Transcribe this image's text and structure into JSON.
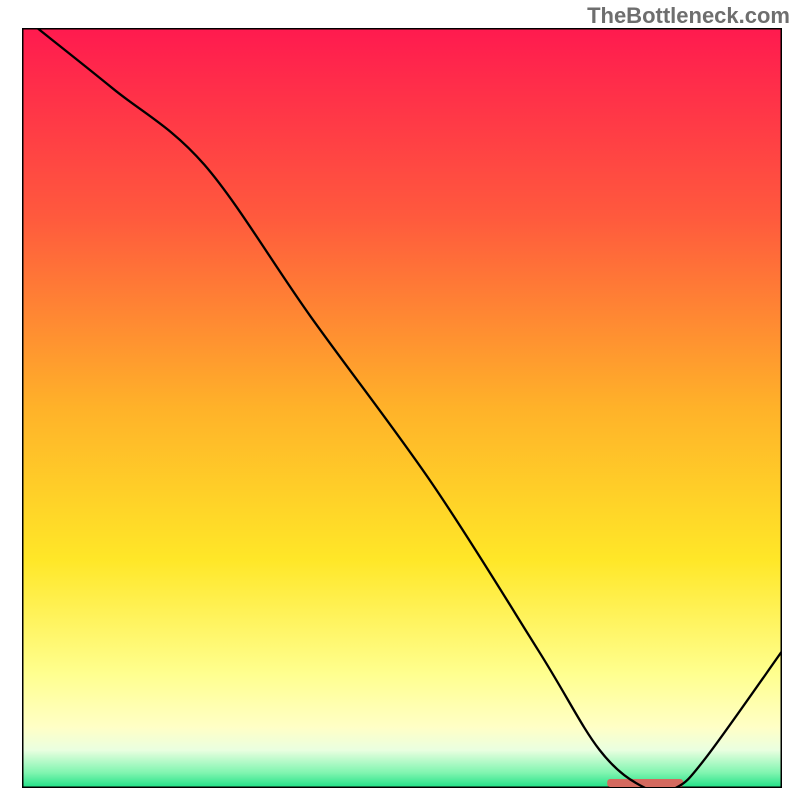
{
  "watermark": "TheBottleneck.com",
  "chart_data": {
    "type": "line",
    "title": "",
    "xlabel": "",
    "ylabel": "",
    "xlim": [
      0,
      100
    ],
    "ylim": [
      0,
      100
    ],
    "series": [
      {
        "name": "curve",
        "x": [
          2,
          12,
          24,
          38,
          54,
          68,
          76,
          82,
          86,
          90,
          100
        ],
        "y": [
          100,
          92,
          82,
          62,
          40,
          18,
          5,
          0,
          0,
          4,
          18
        ]
      }
    ],
    "markers": [
      {
        "name": "red-band",
        "x_start": 77,
        "x_end": 87,
        "y": 0,
        "color": "#d46a5f"
      }
    ],
    "background": {
      "gradient_stops": [
        {
          "offset": 0.0,
          "color": "#ff1a4f"
        },
        {
          "offset": 0.25,
          "color": "#ff5a3d"
        },
        {
          "offset": 0.5,
          "color": "#ffb229"
        },
        {
          "offset": 0.7,
          "color": "#ffe728"
        },
        {
          "offset": 0.85,
          "color": "#ffff8f"
        },
        {
          "offset": 0.92,
          "color": "#ffffc6"
        },
        {
          "offset": 0.95,
          "color": "#eaffe0"
        },
        {
          "offset": 0.98,
          "color": "#80f5b0"
        },
        {
          "offset": 1.0,
          "color": "#1de085"
        }
      ]
    }
  }
}
